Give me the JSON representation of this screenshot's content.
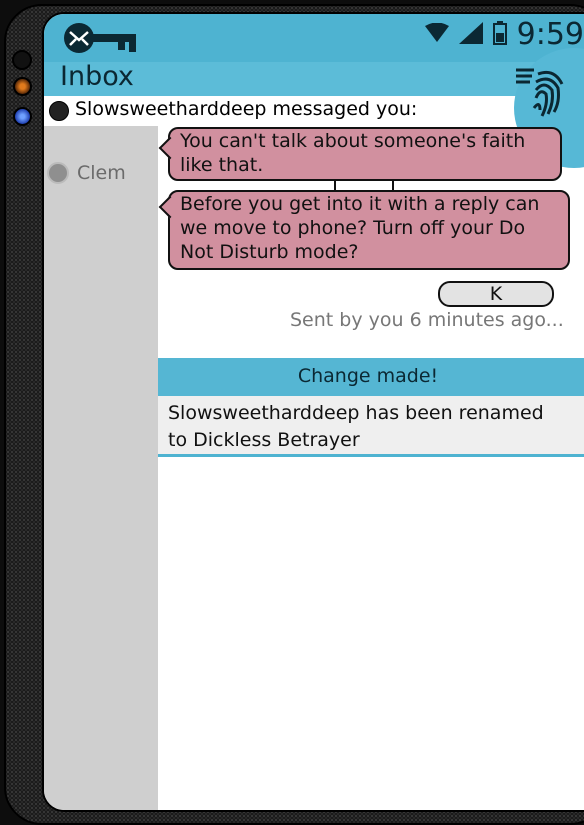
{
  "status_bar": {
    "time": "9:59",
    "wifi_icon": "wifi-icon",
    "signal_icon": "signal-icon",
    "battery_icon": "battery-icon",
    "app_logo_icon": "mail-key-logo"
  },
  "header": {
    "title": "Inbox",
    "fingerprint_icon": "fingerprint-icon"
  },
  "notification": {
    "text": "Slowsweetharddeep messaged you:"
  },
  "contacts": [
    {
      "name": "Clem"
    }
  ],
  "messages": [
    {
      "text": "You can't talk about someone's faith like that."
    },
    {
      "text": "Before you get into it with a reply can we move to phone?  Turn off your Do Not Disturb mode?"
    }
  ],
  "reply": {
    "text": "K",
    "meta": "Sent by you 6 minutes ago..."
  },
  "change_notice": {
    "title": "Change made!",
    "body": "Slowsweetharddeep has been renamed to Dickless Betrayer"
  },
  "colors": {
    "accent": "#4eb3d1",
    "bubble_incoming": "#d1909f",
    "bubble_outgoing": "#e3e3e3",
    "sidebar": "#cfcfcf"
  }
}
